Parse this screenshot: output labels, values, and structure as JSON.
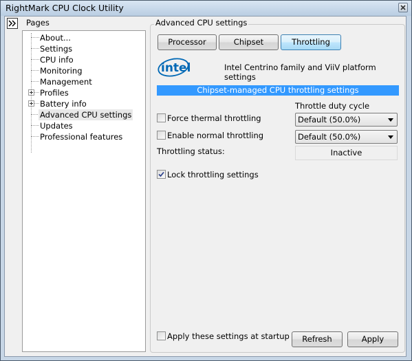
{
  "window": {
    "title": "RightMark CPU Clock Utility"
  },
  "sidebar": {
    "header": "Pages",
    "items": [
      {
        "label": "About..."
      },
      {
        "label": "Settings"
      },
      {
        "label": "CPU info"
      },
      {
        "label": "Monitoring"
      },
      {
        "label": "Management"
      },
      {
        "label": "Profiles",
        "expandable": true
      },
      {
        "label": "Battery info",
        "expandable": true
      },
      {
        "label": "Advanced CPU settings",
        "selected": true
      },
      {
        "label": "Updates"
      },
      {
        "label": "Professional features"
      }
    ]
  },
  "main": {
    "group_title": "Advanced CPU settings",
    "tabs": [
      {
        "label": "Processor"
      },
      {
        "label": "Chipset"
      },
      {
        "label": "Throttling",
        "active": true
      }
    ],
    "logo_text": "intel",
    "platform_text": "Intel Centrino family and ViiV platform settings",
    "section_header": "Chipset-managed CPU throttling settings",
    "force_thermal": {
      "label": "Force thermal throttling",
      "checked": false
    },
    "enable_normal": {
      "label": "Enable normal throttling",
      "checked": false
    },
    "duty_cycle_label": "Throttle duty cycle",
    "duty_select_1": "Default (50.0%)",
    "duty_select_2": "Default (50.0%)",
    "status_label": "Throttling status:",
    "status_value": "Inactive",
    "lock": {
      "label": "Lock throttling settings",
      "checked": true
    },
    "apply_startup": {
      "label": "Apply these settings at startup",
      "checked": false
    },
    "refresh_label": "Refresh",
    "apply_label": "Apply"
  },
  "colors": {
    "accent": "#3399ff",
    "intel_blue": "#0068b5",
    "active_tab": "#bee6fd"
  }
}
